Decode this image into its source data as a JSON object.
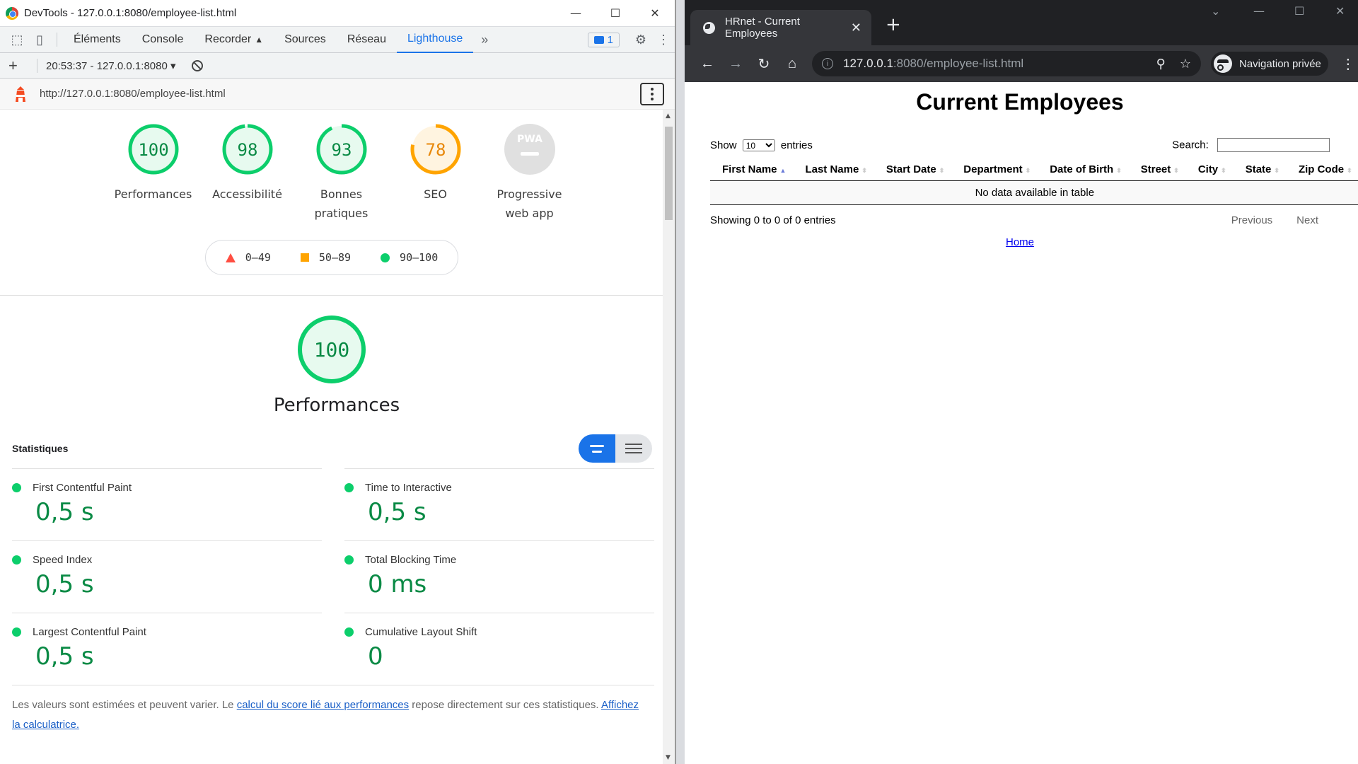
{
  "devtools": {
    "window_title": "DevTools - 127.0.0.1:8080/employee-list.html",
    "tabs": [
      "Éléments",
      "Console",
      "Recorder",
      "Sources",
      "Réseau",
      "Lighthouse"
    ],
    "active_tab": "Lighthouse",
    "issues_count": "1",
    "report_selector": "20:53:37 - 127.0.0.1:8080",
    "report_url": "http://127.0.0.1:8080/employee-list.html"
  },
  "lighthouse": {
    "categories": [
      {
        "score": "100",
        "label1": "Performances",
        "label2": "",
        "color": "#0cce6b",
        "fraction": 1.0
      },
      {
        "score": "98",
        "label1": "Accessibilité",
        "label2": "",
        "color": "#0cce6b",
        "fraction": 0.98
      },
      {
        "score": "93",
        "label1": "Bonnes",
        "label2": "pratiques",
        "color": "#0cce6b",
        "fraction": 0.93
      },
      {
        "score": "78",
        "label1": "SEO",
        "label2": "",
        "color": "#ffa400",
        "fraction": 0.78
      },
      {
        "score": "PWA",
        "label1": "Progressive",
        "label2": "web app",
        "color": "#e0e0e0",
        "fraction": 0
      }
    ],
    "legend": {
      "fail": "0–49",
      "average": "50–89",
      "pass": "90–100"
    },
    "perf_score": "100",
    "perf_title": "Performances",
    "stats_heading": "Statistiques",
    "metrics": [
      {
        "name": "First Contentful Paint",
        "value": "0,5 s"
      },
      {
        "name": "Time to Interactive",
        "value": "0,5 s"
      },
      {
        "name": "Speed Index",
        "value": "0,5 s"
      },
      {
        "name": "Total Blocking Time",
        "value": "0 ms"
      },
      {
        "name": "Largest Contentful Paint",
        "value": "0,5 s"
      },
      {
        "name": "Cumulative Layout Shift",
        "value": "0"
      }
    ],
    "note_prefix": "Les valeurs sont estimées et peuvent varier. Le ",
    "note_link1": "calcul du score lié aux performances",
    "note_middle": " repose directement sur ces statistiques. ",
    "note_link2": "Affichez la calculatrice."
  },
  "browser": {
    "tab_title": "HRnet - Current Employees",
    "url_host": "127.0.0.1",
    "url_path": ":8080/employee-list.html",
    "incognito_label": "Navigation privée"
  },
  "page": {
    "heading": "Current Employees",
    "show_label": "Show",
    "page_size": "10",
    "entries_label": "entries",
    "search_label": "Search:",
    "columns": [
      "First Name",
      "Last Name",
      "Start Date",
      "Department",
      "Date of Birth",
      "Street",
      "City",
      "State",
      "Zip Code"
    ],
    "empty_text": "No data available in table",
    "info": "Showing 0 to 0 of 0 entries",
    "previous": "Previous",
    "next": "Next",
    "home_link": "Home"
  },
  "colors": {
    "pass": "#0cce6b",
    "average": "#ffa400",
    "fail": "#ff4e42",
    "accent": "#1a73e8"
  }
}
